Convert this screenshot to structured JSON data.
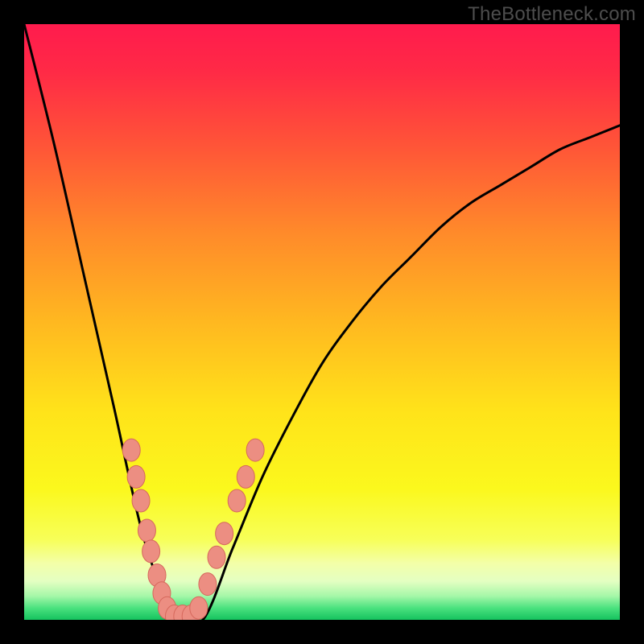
{
  "watermark": "TheBottleneck.com",
  "colors": {
    "frame": "#000000",
    "watermark_text": "#4d4d4d",
    "curve": "#000000",
    "marker_fill": "#ec8e82",
    "marker_stroke": "#d6685c",
    "gradient_stops": [
      {
        "offset": 0.0,
        "color": "#ff1b4d"
      },
      {
        "offset": 0.08,
        "color": "#ff2a46"
      },
      {
        "offset": 0.2,
        "color": "#ff5338"
      },
      {
        "offset": 0.35,
        "color": "#ff8a2a"
      },
      {
        "offset": 0.5,
        "color": "#ffb820"
      },
      {
        "offset": 0.65,
        "color": "#ffe31a"
      },
      {
        "offset": 0.78,
        "color": "#fbf81d"
      },
      {
        "offset": 0.865,
        "color": "#f7ff58"
      },
      {
        "offset": 0.905,
        "color": "#f3ffa8"
      },
      {
        "offset": 0.935,
        "color": "#e4ffc2"
      },
      {
        "offset": 0.96,
        "color": "#a5f7a8"
      },
      {
        "offset": 0.98,
        "color": "#4be27f"
      },
      {
        "offset": 1.0,
        "color": "#15c25e"
      }
    ]
  },
  "chart_data": {
    "type": "line",
    "title": "",
    "xlabel": "",
    "ylabel": "",
    "xlim": [
      0,
      100
    ],
    "ylim": [
      0,
      100
    ],
    "notch_x": 25,
    "categories_x_percent": [
      0,
      5,
      10,
      15,
      20,
      25,
      30,
      35,
      40,
      45,
      50,
      55,
      60,
      65,
      70,
      75,
      80,
      85,
      90,
      95,
      100
    ],
    "series": [
      {
        "name": "bottleneck-curve",
        "x": [
          0,
          5,
          10,
          15,
          20,
          25,
          30,
          35,
          40,
          45,
          50,
          55,
          60,
          65,
          70,
          75,
          80,
          85,
          90,
          95,
          100
        ],
        "y": [
          100,
          80,
          58,
          36,
          14,
          0,
          0,
          12,
          24,
          34,
          43,
          50,
          56,
          61,
          66,
          70,
          73,
          76,
          79,
          81,
          83
        ]
      }
    ],
    "markers": [
      {
        "x": 18.0,
        "y": 28.5
      },
      {
        "x": 18.8,
        "y": 24.0
      },
      {
        "x": 19.6,
        "y": 20.0
      },
      {
        "x": 20.6,
        "y": 15.0
      },
      {
        "x": 21.3,
        "y": 11.5
      },
      {
        "x": 22.3,
        "y": 7.5
      },
      {
        "x": 23.1,
        "y": 4.5
      },
      {
        "x": 24.0,
        "y": 2.0
      },
      {
        "x": 25.2,
        "y": 0.6
      },
      {
        "x": 26.6,
        "y": 0.6
      },
      {
        "x": 28.0,
        "y": 0.6
      },
      {
        "x": 29.3,
        "y": 2.0
      },
      {
        "x": 30.8,
        "y": 6.0
      },
      {
        "x": 32.3,
        "y": 10.5
      },
      {
        "x": 33.6,
        "y": 14.5
      },
      {
        "x": 35.7,
        "y": 20.0
      },
      {
        "x": 37.2,
        "y": 24.0
      },
      {
        "x": 38.8,
        "y": 28.5
      }
    ]
  }
}
